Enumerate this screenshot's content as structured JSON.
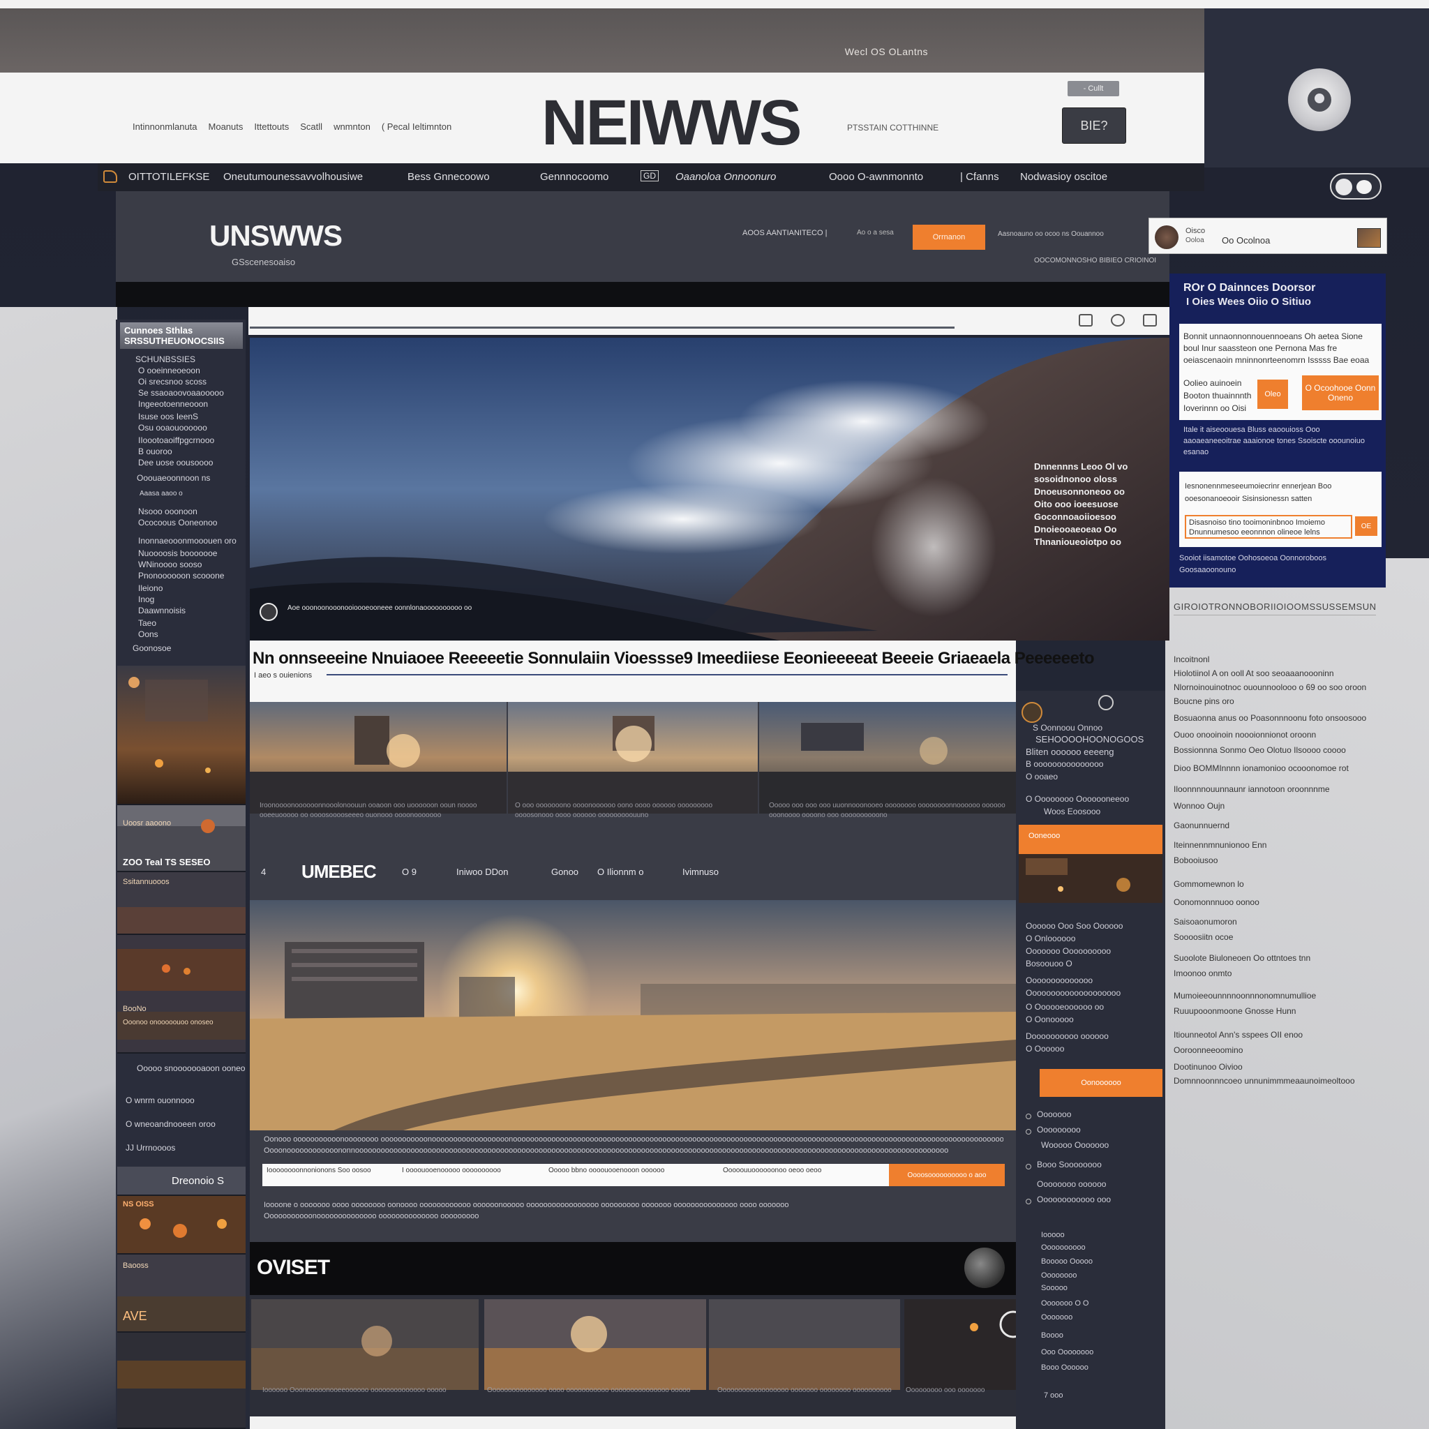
{
  "colors": {
    "accent": "#ef7f2e",
    "navy": "#16205a",
    "dark": "#2a2d3b",
    "masthead": "#f4f4f4"
  },
  "top_bar": {
    "links": "Wecl OS OLantns"
  },
  "masthead": {
    "links": [
      "Intinnonmlanuta",
      "Moanuts",
      "Ittettouts",
      "Scatll",
      "wnmnton",
      "( Pecal Ieltimnton"
    ],
    "logo": "NEIWWS",
    "tagline": "PTSSTAIN COTTHINNE",
    "small_button": "- Cullt",
    "dark_button": "BIE?",
    "brand_icon": "brand-circle-icon"
  },
  "primary_nav": {
    "items": [
      "OITTOTILEFKSE",
      "Oneutumounessavvolhousiwe",
      "Bess Gnnecoowo",
      "Gennnocoomo",
      "Oaanoloa Onnoonuro",
      "Oooo O-awnmonnto",
      "| Cfanns",
      "Nodwasioy oscitoe"
    ],
    "glyph": "GD"
  },
  "sub_header": {
    "logo": "UNSWWS",
    "tagline": "GSscenesoaiso",
    "link1": "AOOS AANTIANITECO |",
    "link2": "Ao o a sesa",
    "button": "Orrnanon",
    "right1": "Aasnoauno oo ocoo ns Oouannoo",
    "right2": "OOCOMONNOSHO BIBIEO CRIOINOI"
  },
  "user_card": {
    "line1": "Oisco",
    "line2": "Oo  Ocolnoa",
    "line3": "Ooloa"
  },
  "promo": {
    "title1": "ROr O Dainnces Doorsor",
    "title2": "I Oies Wees Oiio O Sitiuo",
    "card1_text": "Bonnit unnaonnonnouennoeans Oh aetea Sione boul Inur saassteon one Pernona Mas fre oeiascenaoin mninnonrteenomrn Isssss Bae eoaa",
    "card1_label": "Oolieo auinoein Booton thuainnnth Ioverinnn oo Oisi",
    "card1_btn1": "Oleo",
    "card1_btn2": "O Ocoohooe Oonn Oneno",
    "mid_text": "Itale it aiseoouesa Bluss eaoouioss Ooo aaoaeaneeoitrae aaaionoe tones Ssoiscte ooounoiuo esanao",
    "card2_text": "Iesnonennmeseeumoiecrinr ennerjean Boo ooesonanoeooir Sisinsionessn satten",
    "card2_wide": "Disasnoiso tino tooimoninbnoo Imoiemo Dnunnumesoo eeonnnon olineoe lelns",
    "card2_btn": "OE",
    "foot_text": "Sooiot iisamotoe Oohosoeoa Oonnoroboos Goosaaoonouno"
  },
  "right_sidebar": {
    "header": "GIROIOTRONNOBORIIOIOOMSSUSSEMSUNOSIHIOINBIIIOO",
    "lines": [
      "Incoitnonl",
      "Hiolotiinol A on ooll At soo seoaaanoooninn",
      "Nlornoinouinotnoc ouounnoolooo o 69 oo soo oroon",
      "Boucne  pins oro",
      "Bosuaonna anus oo  Poasonnnoonu foto onsoosooo",
      "Ouoo onooinoin noooionnionot oroonn",
      "Bossionnna  Sonmo  Oeo  Olotuo Ilsoooo coooo",
      "Dioo BOMMInnnn ionamonioo ocooonomoe rot",
      "Iloonnnnouunnaunr iannotoon oroonnnme",
      "Wonnoo  Oujn",
      "Gaonunnuernd",
      "Iteinnennmnunionoo Enn",
      "Bobooiusoo",
      "Gommomewnon lo",
      "Oonomonnnuoo oonoo",
      "Saisoaonumoron",
      "Soooosiitn ocoe",
      "Suoolote Biuloneoen Oo ottntoes tnn",
      "Imoonoo onmto",
      "Mumoieeounnnnoonnnonomnumullioe",
      "Ruuupooonmoone Gnosse  Hunn",
      "Itiounneotol Ann's  sspees OII enoo",
      "Ooroonneeoomino",
      "Dootinunoo  Oivioo",
      "Domnnoonnncoeo unnunimmmeaaunoimeoltooo"
    ]
  },
  "left_col": {
    "title": "Cunnoes Sthlas SRSSUTHEUONOCSIIS",
    "links": [
      "SCHUNBSSIES",
      "O ooeinneoeoon",
      "Oi srecsnoo scoss",
      "Se ssaoaoovoaaooooo",
      "Ingeeotoenneooon",
      "Isuse oos  IeenS",
      "Osu ooaouoooooo",
      "IIoootoaoiffpgcrnooo",
      "B ouoroo",
      "Dee uose  oousoooo",
      "Ooouaeoonnoon ns",
      "Aaasa  aaoo  o",
      "Nsooo ooonoon",
      "Ococoous  Ooneonoo",
      "Inonnaeooonmooouen oro",
      "Nuoooosis booooooe",
      "WNinoooo  sooso",
      "Pnonoooooon scooone",
      "Ileiono",
      "Inog",
      "Daawnnoisis",
      "Taeo",
      "Oons",
      "Goonosoe"
    ],
    "thumbs": [
      "",
      "",
      "Uoosr aaoono",
      "ZOO Teal  TS SESEO",
      "Ssitannuooos",
      "BooNo",
      "",
      "Ooonoo onooooouoo onoseo",
      "Dreonoio S",
      "NS OISS",
      "Baooss",
      "AVE"
    ],
    "captions": [
      "Ooooo snooooooaoon ooneo",
      "O  wnrm ouonnooo",
      "O wneoandnooeen oroo",
      "JJ  Urrnoooos"
    ]
  },
  "center": {
    "toolbar_icons": [
      "grid-icon",
      "question-icon",
      "expand-icon"
    ],
    "hero_caption": "Dnnennns Leoo Ol vo sosoidnonoo oloss Dnoeusonnoneoo oo Oito ooo ioeesuose Goconnoaoiioesoo Dnoieooaeoeao Oo Thnanioueoiotpo oo",
    "hero_footer": "Aoe ooonoonooonooioooeooneee oonnlonaoooooooooo oo",
    "headline": "Nn onnseeeine Nnuiaoee Reeeeetie Sonnulaiin Vioessse9 Imeediiese Eeonieeeeat Beeeie Griaeaela Peeeeeeto",
    "headline_sub": "I aeo s  ouienions",
    "tri_captions": [
      "Iroonoooonoooooonnooolonoouun ooaoon ooo uoooooon ooun noooo ooeeuooooo oo oooosooooseeeo ouonooo oooonooooooo",
      "O ooo ooooooono oooonoooooo oono oooo oooooo ooooooooo oooosonooo oooo oooooo ooooooooouuno",
      "Ooooo ooo ooo ooo uuonnooonooeo oooooooo oooooooonnoooooo oooooo ooonoooo oooono ooo oooooooooono"
    ],
    "strip_brand": "UMEBEC",
    "strip_nav": [
      "4",
      "O 9",
      "Iniwoo  DDon",
      "Gonoo",
      "O Ilionnm o",
      "Ivimnuso"
    ],
    "big_para1": "Oonooo ooooooooooonoooooooo ooooooooooonoooooooooooooooooonoooooooooooooooooooooooooooooooooooooooooooooooooooooooooooooooooooooooooooooooooooooooooooooooooooooooooooooooooooooooooooooooooooooo",
    "big_para2": "Oooonoooooooooooononnooooooooooooooooooooooooooooooooooooooooooooooooooooooooooooooooooooooooooooooooooooooooooooooooooooooooooooooooooooooooooooooooooooooooooo",
    "bar_segs": [
      "Ioooooooonnonionons Soo oosoo",
      "I oooouooenooooo oooooooooo",
      "Ooooo bbno oooouooenooon oooooo",
      "Ooooouuoooooonoo oeoo oeoo"
    ],
    "bar_btn": "Oooosoooooooooo o aoo",
    "big_para3": "Ioooone o ooooooo oooo oooooooo oonoooo oooooooooooo oooooonooooo ooooooooooooooooo ooooooooo ooooooo ooooooooooooooo oooo ooooooo",
    "big_para4": "Ooooooooooonoooooooooooooo oooooooooooooo  ooooooooo",
    "ov_title": "OVISET",
    "bottom_captions": [
      "Ioooooo  Ooonooooonooeeoooooo oooooooooooooo ooooo",
      "Ooooooooooooooo oooo ooooooooooo ooooooooooooooo ooooo",
      "Oooooooooooooooooo ooooooo oooooooo oooooooooo",
      "Ooooooooo ooo ooooooo"
    ]
  },
  "cr_col": {
    "top_lines": [
      "S  Oonnoou Onnoo",
      "SEHOOOOHOONOGOOS",
      "Bliten oooooo eeeeng",
      "B ooooooooooooooo",
      "O ooaeo",
      "O  Oooooooo  Ooooooneeoo",
      "Woos  Eoosooo"
    ],
    "orange_head": "Ooneooo",
    "lines": [
      "Oooooo    Ooo Soo Oooooo",
      "O Onloooooo",
      "Ooooooo  Oooooooooo",
      "Bosoouoo  O",
      "Oooooooooooooo",
      "Oooooooooooooooooooo",
      "O Oooooeoooooo oo",
      "O   Oonooooo",
      "Doooooooooo  oooooo",
      "O  Oooooo"
    ],
    "button": "Oonoooooo",
    "list": [
      "Ooooooo",
      "Ooooooooo",
      "Wooooo  Ooooooo",
      "Booo  Soooooooo",
      "Oooooooo  oooooo",
      "Oooooooooooo  ooo"
    ],
    "lower": [
      "Iooooo",
      "Oooooooooo",
      "Booooo  Ooooo",
      "Oooooooo",
      "Sooooo",
      "Ooooooo  O O",
      "Ooooooo",
      "Boooo",
      "Ooo  Oooooooo",
      "Booo  Oooooo",
      "7 ooo"
    ]
  }
}
